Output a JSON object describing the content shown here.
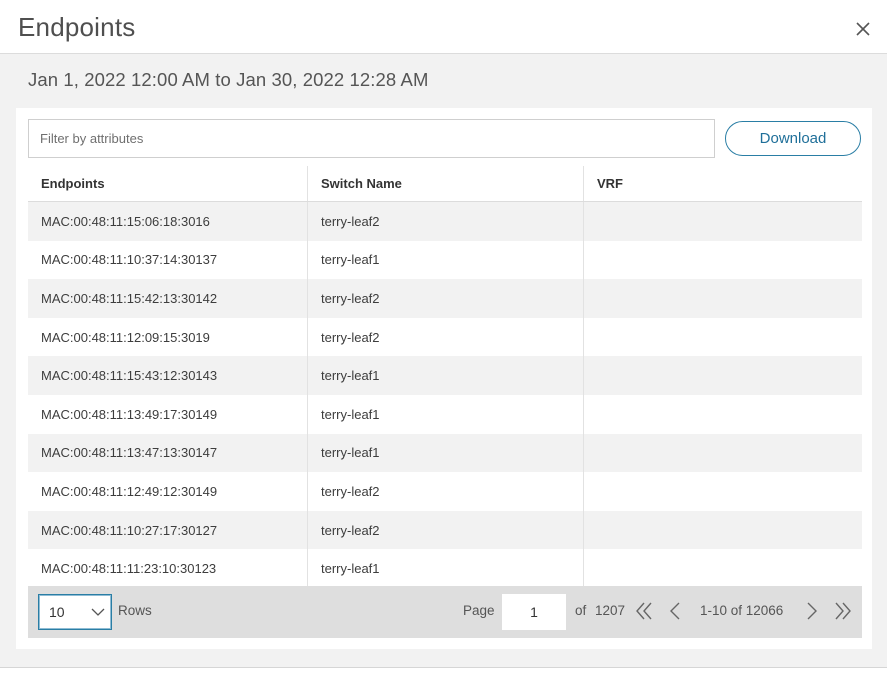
{
  "modal": {
    "title": "Endpoints",
    "date_range": "Jan 1, 2022 12:00 AM to Jan 30, 2022 12:28 AM"
  },
  "toolbar": {
    "filter_placeholder": "Filter by attributes",
    "filter_value": "",
    "download_label": "Download"
  },
  "table": {
    "columns": [
      "Endpoints",
      "Switch Name",
      "VRF"
    ],
    "rows": [
      {
        "endpoint": "MAC:00:48:11:15:06:18:3016",
        "switch": "terry-leaf2",
        "vrf": ""
      },
      {
        "endpoint": "MAC:00:48:11:10:37:14:30137",
        "switch": "terry-leaf1",
        "vrf": ""
      },
      {
        "endpoint": "MAC:00:48:11:15:42:13:30142",
        "switch": "terry-leaf2",
        "vrf": ""
      },
      {
        "endpoint": "MAC:00:48:11:12:09:15:3019",
        "switch": "terry-leaf2",
        "vrf": ""
      },
      {
        "endpoint": "MAC:00:48:11:15:43:12:30143",
        "switch": "terry-leaf1",
        "vrf": ""
      },
      {
        "endpoint": "MAC:00:48:11:13:49:17:30149",
        "switch": "terry-leaf1",
        "vrf": ""
      },
      {
        "endpoint": "MAC:00:48:11:13:47:13:30147",
        "switch": "terry-leaf1",
        "vrf": ""
      },
      {
        "endpoint": "MAC:00:48:11:12:49:12:30149",
        "switch": "terry-leaf2",
        "vrf": ""
      },
      {
        "endpoint": "MAC:00:48:11:10:27:17:30127",
        "switch": "terry-leaf2",
        "vrf": ""
      },
      {
        "endpoint": "MAC:00:48:11:11:23:10:30123",
        "switch": "terry-leaf1",
        "vrf": ""
      }
    ]
  },
  "pagination": {
    "rows_per_page": "10",
    "rows_label": "Rows",
    "page_label": "Page",
    "current_page": "1",
    "of_label": "of",
    "total_pages": "1207",
    "range_label": "1-10 of 12066"
  },
  "icons": {
    "close": "close-icon",
    "dropdown": "chevron-down-icon",
    "first": "double-chevron-left-icon",
    "prev": "chevron-left-icon",
    "next": "chevron-right-icon",
    "last": "double-chevron-right-icon"
  },
  "colors": {
    "accent": "#2a7ea5",
    "panel_bg": "#f2f2f2",
    "pager_bg": "#dedede"
  }
}
